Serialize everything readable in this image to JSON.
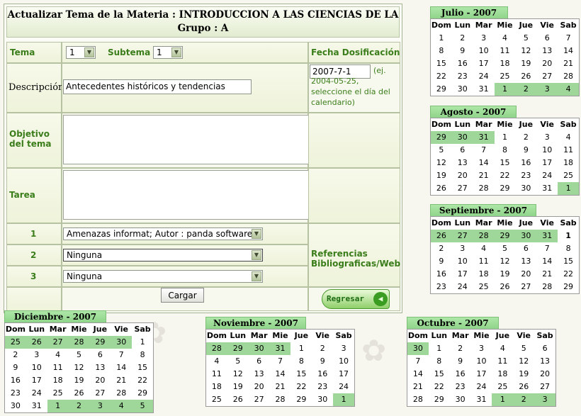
{
  "header": {
    "line1": "Actualizar Tema de la Materia : INTRODUCCION A LAS CIENCIAS DE LA",
    "line2": "Grupo : A"
  },
  "form": {
    "tema_label": "Tema",
    "tema_value": "1",
    "subtema_label": "Subtema",
    "subtema_value": "1",
    "fecha_label": "Fecha Dosificación",
    "fecha_value": "2007-7-1",
    "fecha_hint": "(ej. 2004-05-25, seleccione el día del calendario)",
    "descripcion_label": "Descripción",
    "descripcion_value": "Antecedentes históricos y tendencias",
    "objetivo_label": "Objetivo del tema",
    "tarea_label": "Tarea",
    "ref_label": "Referencias Bibliograficas/Web",
    "references": [
      {
        "num": "1",
        "value": "Amenazas informat; Autor : panda software"
      },
      {
        "num": "2",
        "value": "Ninguna"
      },
      {
        "num": "3",
        "value": "Ninguna"
      }
    ],
    "cargar_label": "Cargar",
    "regresar_label": "Regresar"
  },
  "weekdays": [
    "Dom",
    "Lun",
    "Mar",
    "Mie",
    "Jue",
    "Vie",
    "Sab"
  ],
  "calendars": [
    {
      "id": "julio",
      "title": "Julio - 2007",
      "days": [
        [
          "1",
          "2",
          "3",
          "4",
          "5",
          "6",
          "7"
        ],
        [
          "8",
          "9",
          "10",
          "11",
          "12",
          "13",
          "14"
        ],
        [
          "15",
          "16",
          "17",
          "18",
          "19",
          "20",
          "21"
        ],
        [
          "22",
          "23",
          "24",
          "25",
          "26",
          "27",
          "28"
        ],
        [
          "29",
          "30",
          "31",
          "1",
          "2",
          "3",
          "4"
        ]
      ],
      "other_start": [],
      "other_end": [
        "1",
        "2",
        "3",
        "4"
      ]
    },
    {
      "id": "agosto",
      "title": "Agosto - 2007",
      "days": [
        [
          "29",
          "30",
          "31",
          "1",
          "2",
          "3",
          "4"
        ],
        [
          "5",
          "6",
          "7",
          "8",
          "9",
          "10",
          "11"
        ],
        [
          "12",
          "13",
          "14",
          "15",
          "16",
          "17",
          "18"
        ],
        [
          "19",
          "20",
          "21",
          "22",
          "23",
          "24",
          "25"
        ],
        [
          "26",
          "27",
          "28",
          "29",
          "30",
          "31",
          "1"
        ]
      ],
      "other_start": [
        "29",
        "30",
        "31"
      ],
      "other_end": [
        "1"
      ]
    },
    {
      "id": "septiembre",
      "title": "Septiembre - 2007",
      "days": [
        [
          "26",
          "27",
          "28",
          "29",
          "30",
          "31",
          "1"
        ],
        [
          "2",
          "3",
          "4",
          "5",
          "6",
          "7",
          "8"
        ],
        [
          "9",
          "10",
          "11",
          "12",
          "13",
          "14",
          "15"
        ],
        [
          "16",
          "17",
          "18",
          "19",
          "20",
          "21",
          "22"
        ],
        [
          "23",
          "24",
          "25",
          "26",
          "27",
          "28",
          "29"
        ]
      ],
      "other_start": [
        "26",
        "27",
        "28",
        "29",
        "30",
        "31"
      ],
      "other_end": []
    },
    {
      "id": "diciembre",
      "title": "Diciembre - 2007",
      "days": [
        [
          "25",
          "26",
          "27",
          "28",
          "29",
          "30",
          "1"
        ],
        [
          "2",
          "3",
          "4",
          "5",
          "6",
          "7",
          "8"
        ],
        [
          "9",
          "10",
          "11",
          "12",
          "13",
          "14",
          "15"
        ],
        [
          "16",
          "17",
          "18",
          "19",
          "20",
          "21",
          "22"
        ],
        [
          "23",
          "24",
          "25",
          "26",
          "27",
          "28",
          "29"
        ],
        [
          "30",
          "31",
          "1",
          "2",
          "3",
          "4",
          "5"
        ]
      ],
      "other_start": [
        "25",
        "26",
        "27",
        "28",
        "29",
        "30"
      ],
      "other_end": [
        "1",
        "2",
        "3",
        "4",
        "5"
      ]
    },
    {
      "id": "noviembre",
      "title": "Noviembre - 2007",
      "days": [
        [
          "28",
          "29",
          "30",
          "31",
          "1",
          "2",
          "3"
        ],
        [
          "4",
          "5",
          "6",
          "7",
          "8",
          "9",
          "10"
        ],
        [
          "11",
          "12",
          "13",
          "14",
          "15",
          "16",
          "17"
        ],
        [
          "18",
          "19",
          "20",
          "21",
          "22",
          "23",
          "24"
        ],
        [
          "25",
          "26",
          "27",
          "28",
          "29",
          "30",
          "1"
        ]
      ],
      "other_start": [
        "28",
        "29",
        "30",
        "31"
      ],
      "other_end": [
        "1"
      ]
    },
    {
      "id": "octubre",
      "title": "Octubre - 2007",
      "days": [
        [
          "30",
          "1",
          "2",
          "3",
          "4",
          "5",
          "6"
        ],
        [
          "7",
          "8",
          "9",
          "10",
          "11",
          "12",
          "13"
        ],
        [
          "14",
          "15",
          "16",
          "17",
          "18",
          "19",
          "20"
        ],
        [
          "21",
          "22",
          "23",
          "24",
          "25",
          "26",
          "27"
        ],
        [
          "28",
          "29",
          "30",
          "31",
          "1",
          "2",
          "3"
        ]
      ],
      "other_start": [
        "30"
      ],
      "other_end": [
        "1",
        "2",
        "3"
      ]
    }
  ],
  "colors": {
    "accent": "#3a7d1a",
    "outside_day": "#9fd69a",
    "calendar_header": "#8fd48a"
  }
}
